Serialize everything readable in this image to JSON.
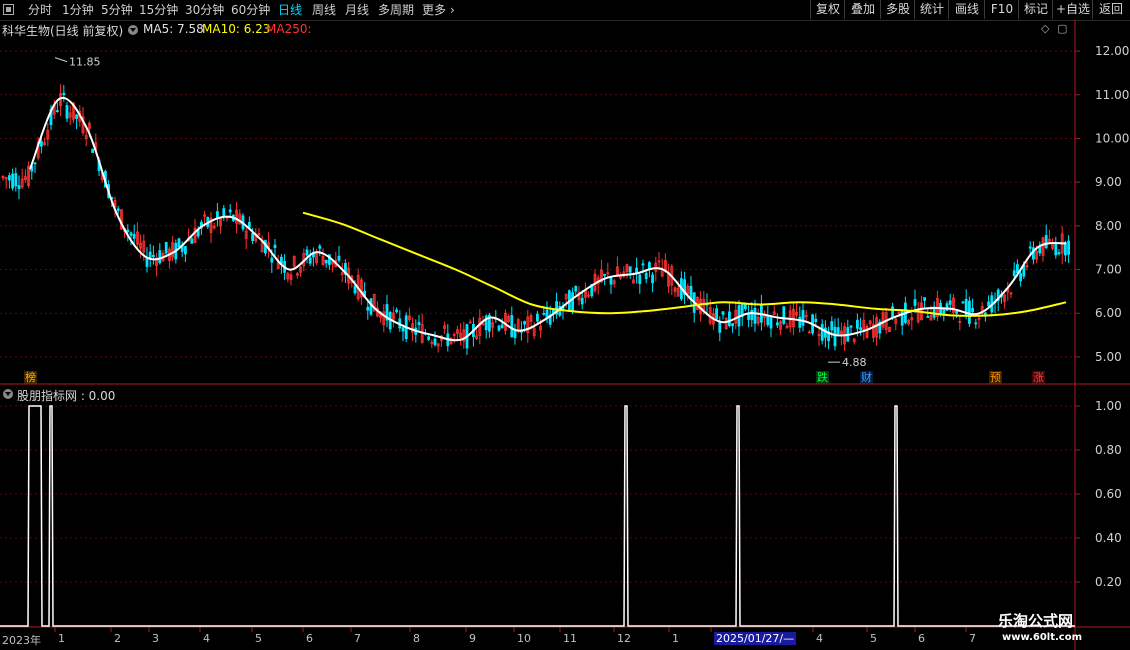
{
  "toolbar": {
    "periods": [
      "分时",
      "1分钟",
      "5分钟",
      "15分钟",
      "30分钟",
      "60分钟",
      "日线",
      "周线",
      "月线",
      "多周期",
      "更多"
    ],
    "active": "日线",
    "buttons": [
      "复权",
      "叠加",
      "多股",
      "统计",
      "画线",
      "F10",
      "标记",
      "+自选",
      "返回"
    ]
  },
  "main_header": {
    "title": "科华生物(日线 前复权)",
    "ma5": "MA5: 7.58",
    "ma10": "MA10: 6.23",
    "ma250": "MA250:"
  },
  "sub_header": {
    "label": "股朋指标网 : 0.00"
  },
  "tags": {
    "bang": "榜",
    "die": "跌",
    "cai": "财",
    "yu": "预",
    "zhang": "涨"
  },
  "watermark": {
    "line1": "乐淘公式网",
    "line2": "www.60lt.com"
  },
  "colors": {
    "up": "#ff3232",
    "down": "#00e4ff",
    "ma_white": "#ffffff",
    "ma_yellow": "#ffff00",
    "axis": "#b01818"
  },
  "chart_data": [
    {
      "type": "line",
      "title": "科华生物(日线 前复权)",
      "ylim": [
        4.7,
        12.3
      ],
      "yticks": [
        "12.00",
        "11.00",
        "10.00",
        "9.00",
        "8.00",
        "7.00",
        "6.00",
        "5.00"
      ],
      "annotations": [
        {
          "label": "11.85",
          "value": 11.85
        },
        {
          "label": "4.88",
          "value": 4.88
        }
      ],
      "x_labels": [
        "2023年",
        "1",
        "2",
        "3",
        "4",
        "5",
        "6",
        "7",
        "8",
        "9",
        "10",
        "11",
        "12",
        "1",
        "2025/01/27/—",
        "4",
        "5",
        "6",
        "7"
      ],
      "series": [
        {
          "name": "MA5",
          "values": [
            9.3,
            10.9,
            10.2,
            8.3,
            7.3,
            7.4,
            8.0,
            8.2,
            7.7,
            7.0,
            7.4,
            6.9,
            6.1,
            5.7,
            5.5,
            5.4,
            5.9,
            5.6,
            5.9,
            6.4,
            6.8,
            6.9,
            7.0,
            6.3,
            5.8,
            6.0,
            5.9,
            5.8,
            5.5,
            5.6,
            5.9,
            6.1,
            6.1,
            6.0,
            6.6,
            7.5,
            7.6
          ]
        },
        {
          "name": "MA10",
          "values": [
            8.3,
            8.05,
            7.7,
            7.35,
            7.0,
            6.6,
            6.2,
            6.05,
            6.0,
            6.05,
            6.15,
            6.25,
            6.2,
            6.25,
            6.2,
            6.1,
            6.05,
            5.95,
            5.95,
            6.05,
            6.25
          ]
        }
      ]
    },
    {
      "type": "line",
      "title": "股朋指标网",
      "current": 0.0,
      "ylim": [
        0,
        1.0
      ],
      "yticks": [
        "1.00",
        "0.80",
        "0.60",
        "0.40",
        "0.20"
      ],
      "signals_x": [
        "2023年",
        "2023年",
        "11",
        "2025/01/27/—",
        "5"
      ]
    }
  ]
}
